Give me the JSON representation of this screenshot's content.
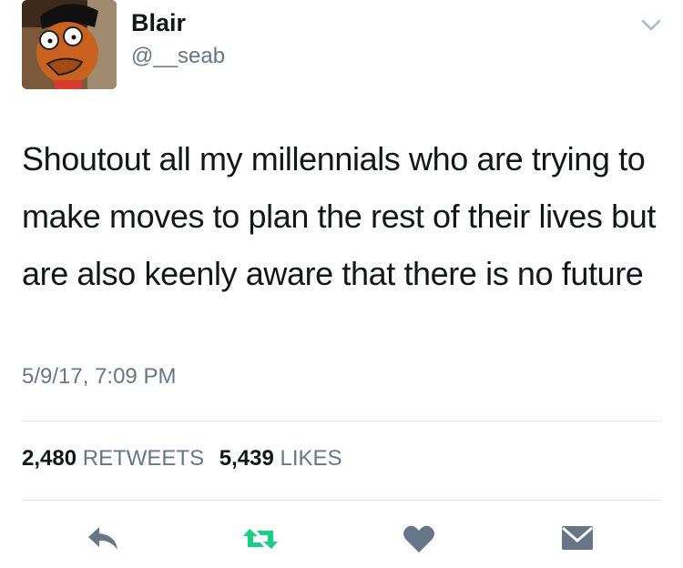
{
  "user": {
    "display_name": "Blair",
    "handle": "@__seab"
  },
  "tweet": {
    "text": "Shoutout all my millennials who are trying to make moves to plan the rest of their lives but are also keenly aware that there is no future",
    "timestamp": "5/9/17, 7:09 PM"
  },
  "stats": {
    "retweets_count": "2,480",
    "retweets_label": "RETWEETS",
    "likes_count": "5,439",
    "likes_label": "LIKES"
  },
  "icons": {
    "chevron": "chevron-down-icon",
    "reply": "reply-icon",
    "retweet": "retweet-icon",
    "like": "heart-icon",
    "message": "envelope-icon"
  },
  "colors": {
    "text": "#14171a",
    "secondary": "#657786",
    "divider": "#e1e8ed",
    "icon": "#657786",
    "retweet_active": "#19cf86"
  }
}
